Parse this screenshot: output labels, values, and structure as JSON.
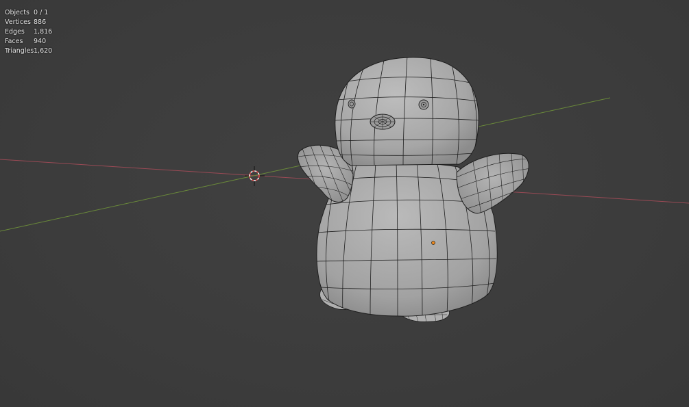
{
  "stats": {
    "rows": [
      {
        "label": "Objects",
        "value": "0 / 1"
      },
      {
        "label": "Vertices",
        "value": "886"
      },
      {
        "label": "Edges",
        "value": "1,816"
      },
      {
        "label": "Faces",
        "value": "940"
      },
      {
        "label": "Triangles",
        "value": "1,620"
      }
    ]
  },
  "colors": {
    "background": "#3d3d3d",
    "x_axis": "#9a4a55",
    "y_axis": "#6a8a3a",
    "mesh_fill": "#a9a9a9",
    "wire": "#1e1e1e",
    "origin": "#f08a20",
    "cursor_red": "#e04a4a"
  },
  "icons": {
    "cursor": "3d-cursor-icon",
    "origin": "object-origin-icon"
  }
}
